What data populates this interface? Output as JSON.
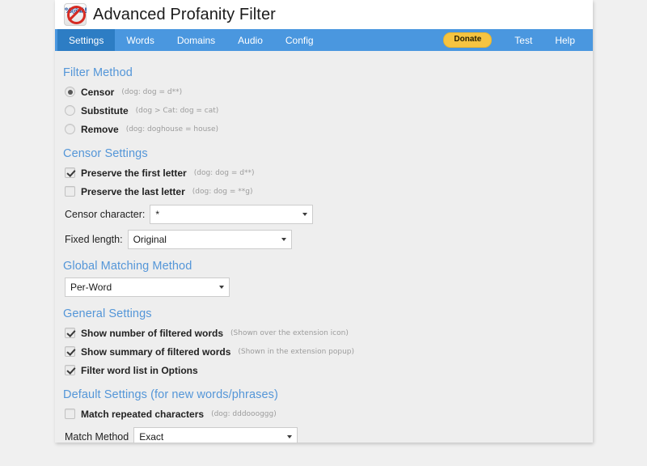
{
  "header": {
    "title": "Advanced Profanity Filter",
    "logo_symbols": "%@#!",
    "logo_name": "apf-logo-icon"
  },
  "nav": {
    "tabs": [
      {
        "label": "Settings",
        "active": true
      },
      {
        "label": "Words",
        "active": false
      },
      {
        "label": "Domains",
        "active": false
      },
      {
        "label": "Audio",
        "active": false
      },
      {
        "label": "Config",
        "active": false
      }
    ],
    "donate_label": "Donate",
    "right_links": [
      {
        "label": "Test"
      },
      {
        "label": "Help"
      }
    ],
    "active_tab_color": "#2d7dc4",
    "bar_color": "#4a97df",
    "donate_color": "#f6c441"
  },
  "sections": {
    "filter_method": {
      "title": "Filter Method",
      "options": [
        {
          "label": "Censor",
          "hint": "(dog: dog = d**)",
          "selected": true
        },
        {
          "label": "Substitute",
          "hint": "(dog > Cat: dog = cat)",
          "selected": false
        },
        {
          "label": "Remove",
          "hint": "(dog: doghouse = house)",
          "selected": false
        }
      ]
    },
    "censor_settings": {
      "title": "Censor Settings",
      "checkboxes": [
        {
          "label": "Preserve the first letter",
          "hint": "(dog: dog = d**)",
          "checked": true
        },
        {
          "label": "Preserve the last letter",
          "hint": "(dog: dog = **g)",
          "checked": false
        }
      ],
      "censor_character": {
        "label": "Censor character:",
        "value": "*"
      },
      "fixed_length": {
        "label": "Fixed length:",
        "value": "Original"
      }
    },
    "global_matching": {
      "title": "Global Matching Method",
      "value": "Per-Word"
    },
    "general_settings": {
      "title": "General Settings",
      "checkboxes": [
        {
          "label": "Show number of filtered words",
          "hint": "(Shown over the extension icon)",
          "checked": true
        },
        {
          "label": "Show summary of filtered words",
          "hint": "(Shown in the extension popup)",
          "checked": true
        },
        {
          "label": "Filter word list in Options",
          "hint": "",
          "checked": true
        }
      ]
    },
    "default_settings": {
      "title": "Default Settings (for new words/phrases)",
      "checkboxes": [
        {
          "label": "Match repeated characters",
          "hint": "(dog: dddoooggg)",
          "checked": false
        }
      ],
      "match_method": {
        "label": "Match Method",
        "value": "Exact"
      }
    }
  }
}
